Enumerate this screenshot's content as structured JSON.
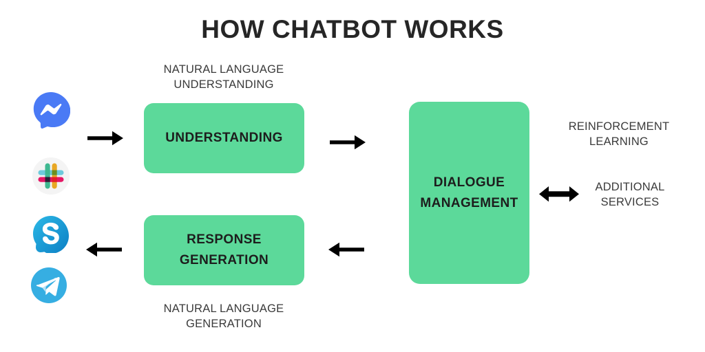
{
  "page": {
    "title": "HOW CHATBOT WORKS",
    "background_color": "#ffffff",
    "accent_green": "#5CD99A",
    "text_color": "#262626"
  },
  "boxes": {
    "understanding": {
      "label": "UNDERSTANDING",
      "color": "#5CD99A"
    },
    "response_generation": {
      "line1": "RESPONSE",
      "line2": "GENERATION",
      "color": "#5CD99A"
    },
    "dialogue_management": {
      "line1": "DIALOGUE",
      "line2": "MANAGEMENT",
      "color": "#5CD99A"
    }
  },
  "captions": {
    "nlu_line1": "NATURAL LANGUAGE",
    "nlu_line2": "UNDERSTANDING",
    "nlg_line1": "NATURAL LANGUAGE",
    "nlg_line2": "GENERATION",
    "reinforcement_line1": "REINFORCEMENT",
    "reinforcement_line2": "LEARNING",
    "additional_line1": "ADDITIONAL",
    "additional_line2": "SERVICES"
  },
  "arrows": [
    {
      "name": "channels-to-understanding",
      "direction": "right"
    },
    {
      "name": "understanding-to-dialogue",
      "direction": "right"
    },
    {
      "name": "dialogue-to-response",
      "direction": "left"
    },
    {
      "name": "response-to-channels",
      "direction": "left"
    },
    {
      "name": "dialogue-to-additional-services",
      "direction": "both"
    }
  ],
  "channels": [
    {
      "name": "messenger-icon",
      "label": "Facebook Messenger",
      "color": "#4A7AF5"
    },
    {
      "name": "slack-icon",
      "label": "Slack",
      "color": "#ECECEC"
    },
    {
      "name": "skype-icon",
      "label": "Skype",
      "color": "#1BA7E0"
    },
    {
      "name": "telegram-icon",
      "label": "Telegram",
      "color": "#36AEE2"
    }
  ]
}
